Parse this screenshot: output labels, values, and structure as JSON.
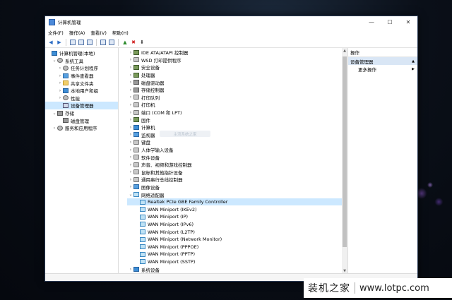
{
  "window": {
    "title": "计算机管理",
    "controls": [
      "—",
      "☐",
      "✕"
    ]
  },
  "menubar": [
    "文件(F)",
    "操作(A)",
    "查看(V)",
    "帮助(H)"
  ],
  "left_tree": [
    {
      "label": "计算机管理(本地)",
      "level": 0,
      "twisty": "",
      "icon": "pc"
    },
    {
      "label": "系统工具",
      "level": 1,
      "twisty": "⌄",
      "icon": "gear"
    },
    {
      "label": "任务计划程序",
      "level": 2,
      "twisty": "›",
      "icon": "gear"
    },
    {
      "label": "事件查看器",
      "level": 2,
      "twisty": "›",
      "icon": "mon"
    },
    {
      "label": "共享文件夹",
      "level": 2,
      "twisty": "›",
      "icon": "folder"
    },
    {
      "label": "本地用户和组",
      "level": 2,
      "twisty": "›",
      "icon": "pc"
    },
    {
      "label": "性能",
      "level": 2,
      "twisty": "›",
      "icon": "gear"
    },
    {
      "label": "设备管理器",
      "level": 2,
      "twisty": "",
      "icon": "sel-dev",
      "selected": true
    },
    {
      "label": "存储",
      "level": 1,
      "twisty": "⌄",
      "icon": "disk"
    },
    {
      "label": "磁盘管理",
      "level": 2,
      "twisty": "",
      "icon": "disk"
    },
    {
      "label": "服务和应用程序",
      "level": 1,
      "twisty": "›",
      "icon": "gear"
    }
  ],
  "device_tree": [
    {
      "label": "IDE ATA/ATAPI 控制器",
      "level": 0,
      "twisty": "›",
      "icon": "chip"
    },
    {
      "label": "WSD 打印提供程序",
      "level": 0,
      "twisty": "›",
      "icon": "spk"
    },
    {
      "label": "安全设备",
      "level": 0,
      "twisty": "›",
      "icon": "chip"
    },
    {
      "label": "处理器",
      "level": 0,
      "twisty": "›",
      "icon": "chip"
    },
    {
      "label": "磁盘驱动器",
      "level": 0,
      "twisty": "›",
      "icon": "disk"
    },
    {
      "label": "存储控制器",
      "level": 0,
      "twisty": "›",
      "icon": "disk"
    },
    {
      "label": "打印队列",
      "level": 0,
      "twisty": "›",
      "icon": "spk"
    },
    {
      "label": "打印机",
      "level": 0,
      "twisty": "›",
      "icon": "spk"
    },
    {
      "label": "端口 (COM 和 LPT)",
      "level": 0,
      "twisty": "›",
      "icon": "spk"
    },
    {
      "label": "固件",
      "level": 0,
      "twisty": "›",
      "icon": "chip"
    },
    {
      "label": "计算机",
      "level": 0,
      "twisty": "›",
      "icon": "pc"
    },
    {
      "label": "监视器",
      "level": 0,
      "twisty": "›",
      "icon": "mon"
    },
    {
      "label": "键盘",
      "level": 0,
      "twisty": "›",
      "icon": "spk"
    },
    {
      "label": "人体学输入设备",
      "level": 0,
      "twisty": "›",
      "icon": "spk"
    },
    {
      "label": "软件设备",
      "level": 0,
      "twisty": "›",
      "icon": "spk"
    },
    {
      "label": "声音、视频和游戏控制器",
      "level": 0,
      "twisty": "›",
      "icon": "spk"
    },
    {
      "label": "鼠标和其他指针设备",
      "level": 0,
      "twisty": "›",
      "icon": "spk"
    },
    {
      "label": "通用串行总线控制器",
      "level": 0,
      "twisty": "›",
      "icon": "spk"
    },
    {
      "label": "图像设备",
      "level": 0,
      "twisty": "›",
      "icon": "mon"
    },
    {
      "label": "网络适配器",
      "level": 0,
      "twisty": "⌄",
      "icon": "net"
    },
    {
      "label": "Realtek PCIe GBE Family Controller",
      "level": 1,
      "twisty": "",
      "icon": "net",
      "selected": true
    },
    {
      "label": "WAN Miniport (IKEv2)",
      "level": 1,
      "twisty": "",
      "icon": "net"
    },
    {
      "label": "WAN Miniport (IP)",
      "level": 1,
      "twisty": "",
      "icon": "net"
    },
    {
      "label": "WAN Miniport (IPv6)",
      "level": 1,
      "twisty": "",
      "icon": "net"
    },
    {
      "label": "WAN Miniport (L2TP)",
      "level": 1,
      "twisty": "",
      "icon": "net"
    },
    {
      "label": "WAN Miniport (Network Monitor)",
      "level": 1,
      "twisty": "",
      "icon": "net"
    },
    {
      "label": "WAN Miniport (PPPOE)",
      "level": 1,
      "twisty": "",
      "icon": "net"
    },
    {
      "label": "WAN Miniport (PPTP)",
      "level": 1,
      "twisty": "",
      "icon": "net"
    },
    {
      "label": "WAN Miniport (SSTP)",
      "level": 1,
      "twisty": "",
      "icon": "net"
    },
    {
      "label": "系统设备",
      "level": 0,
      "twisty": "›",
      "icon": "pc"
    }
  ],
  "overlay_text": "主流系统之家",
  "actions": {
    "header": "操作",
    "group": "设备管理器",
    "group_arrow": "▲",
    "item": "更多操作",
    "item_arrow": "▶"
  },
  "brand": {
    "name": "装机之家",
    "url": "www.lotpc.com"
  }
}
